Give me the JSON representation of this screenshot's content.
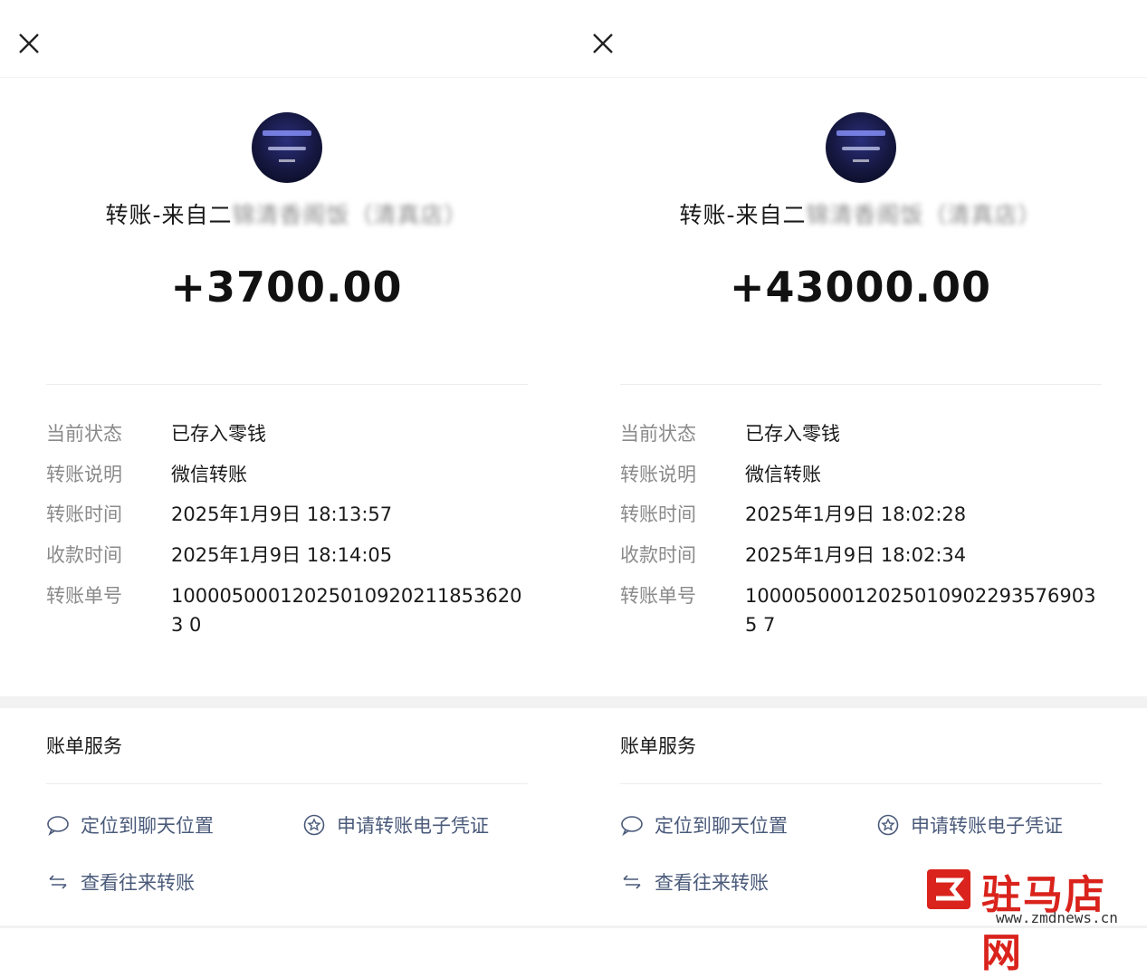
{
  "receipts": [
    {
      "sender_visible": "转账-来自二",
      "sender_blurred": "锦清香阁饭（清真店）",
      "amount": "+3700.00",
      "details": [
        {
          "label": "当前状态",
          "value": "已存入零钱"
        },
        {
          "label": "转账说明",
          "value": "微信转账"
        },
        {
          "label": "转账时间",
          "value": "2025年1月9日 18:13:57"
        },
        {
          "label": "收款时间",
          "value": "2025年1月9日 18:14:05"
        },
        {
          "label": "转账单号",
          "value": "100005000120250109202118536203 0"
        }
      ],
      "services_title": "账单服务",
      "links": {
        "locate_chat": "定位到聊天位置",
        "apply_voucher": "申请转账电子凭证",
        "view_history": "查看往来转账"
      }
    },
    {
      "sender_visible": "转账-来自二",
      "sender_blurred": "锦清香阁饭（清真店）",
      "amount": "+43000.00",
      "details": [
        {
          "label": "当前状态",
          "value": "已存入零钱"
        },
        {
          "label": "转账说明",
          "value": "微信转账"
        },
        {
          "label": "转账时间",
          "value": "2025年1月9日 18:02:28"
        },
        {
          "label": "收款时间",
          "value": "2025年1月9日 18:02:34"
        },
        {
          "label": "转账单号",
          "value": "100005000120250109022935769035 7"
        }
      ],
      "services_title": "账单服务",
      "links": {
        "locate_chat": "定位到聊天位置",
        "apply_voucher": "申请转账电子凭证",
        "view_history": "查看往来转账"
      }
    }
  ],
  "watermark": {
    "brand": "驻马店网",
    "url": "www.zmdnews.cn",
    "color": "#d9231c"
  },
  "icons": {
    "close": "close-icon",
    "chat": "chat-bubble-icon",
    "voucher": "star-badge-icon",
    "history": "transfer-arrows-icon"
  },
  "colors": {
    "link": "#4a5a7a",
    "label": "#8a8a8a",
    "text": "#1a1a1a"
  }
}
